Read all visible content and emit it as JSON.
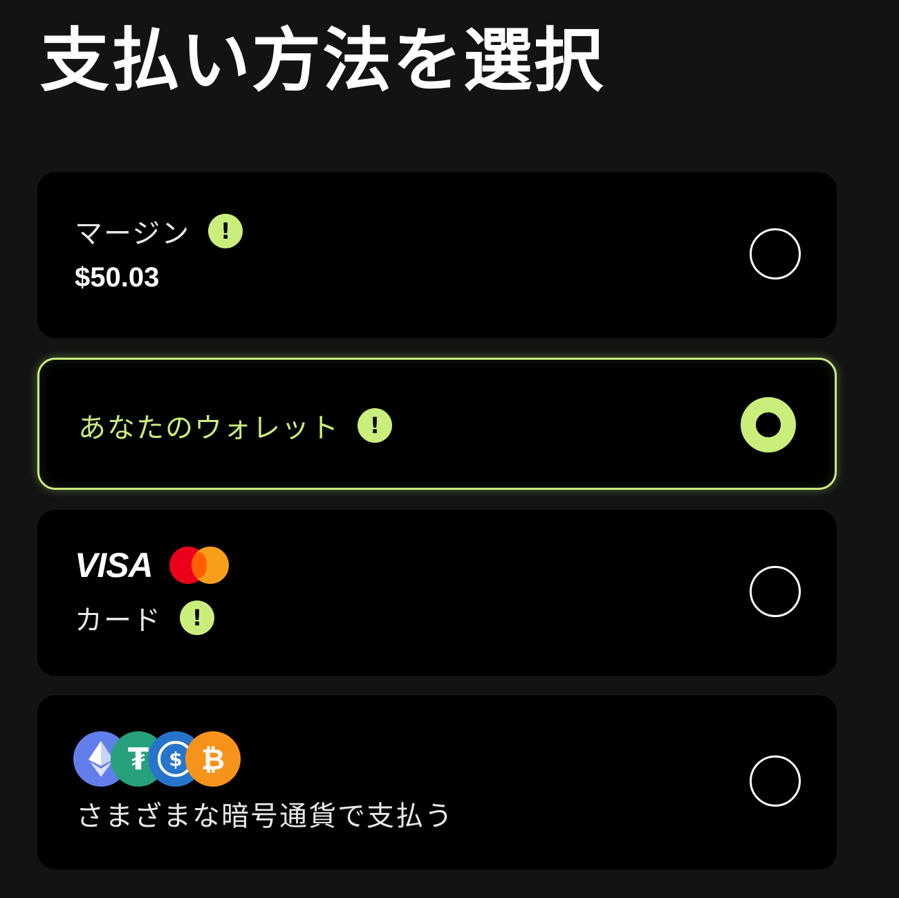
{
  "page": {
    "title": "支払い方法を選択"
  },
  "options": {
    "margin": {
      "label": "マージン",
      "amount": "$50.03",
      "info_icon": "info-icon",
      "selected": false
    },
    "wallet": {
      "label": "あなたのウォレット",
      "info_icon": "info-icon",
      "selected": true
    },
    "card": {
      "brands": {
        "visa": "VISA",
        "mastercard": "mastercard-logo"
      },
      "label": "カード",
      "info_icon": "info-icon",
      "selected": false
    },
    "crypto": {
      "coins": [
        "ethereum-icon",
        "tether-icon",
        "usdc-icon",
        "bitcoin-icon"
      ],
      "label": "さまざまな暗号通貨で支払う",
      "selected": false
    }
  },
  "colors": {
    "background": "#131313",
    "card": "#000000",
    "accent": "#c9ee7c",
    "text": "#ffffff"
  },
  "glyphs": {
    "info": "!",
    "eth": "◆",
    "usdt": "₮",
    "usdc": "$",
    "btc": "₿"
  }
}
